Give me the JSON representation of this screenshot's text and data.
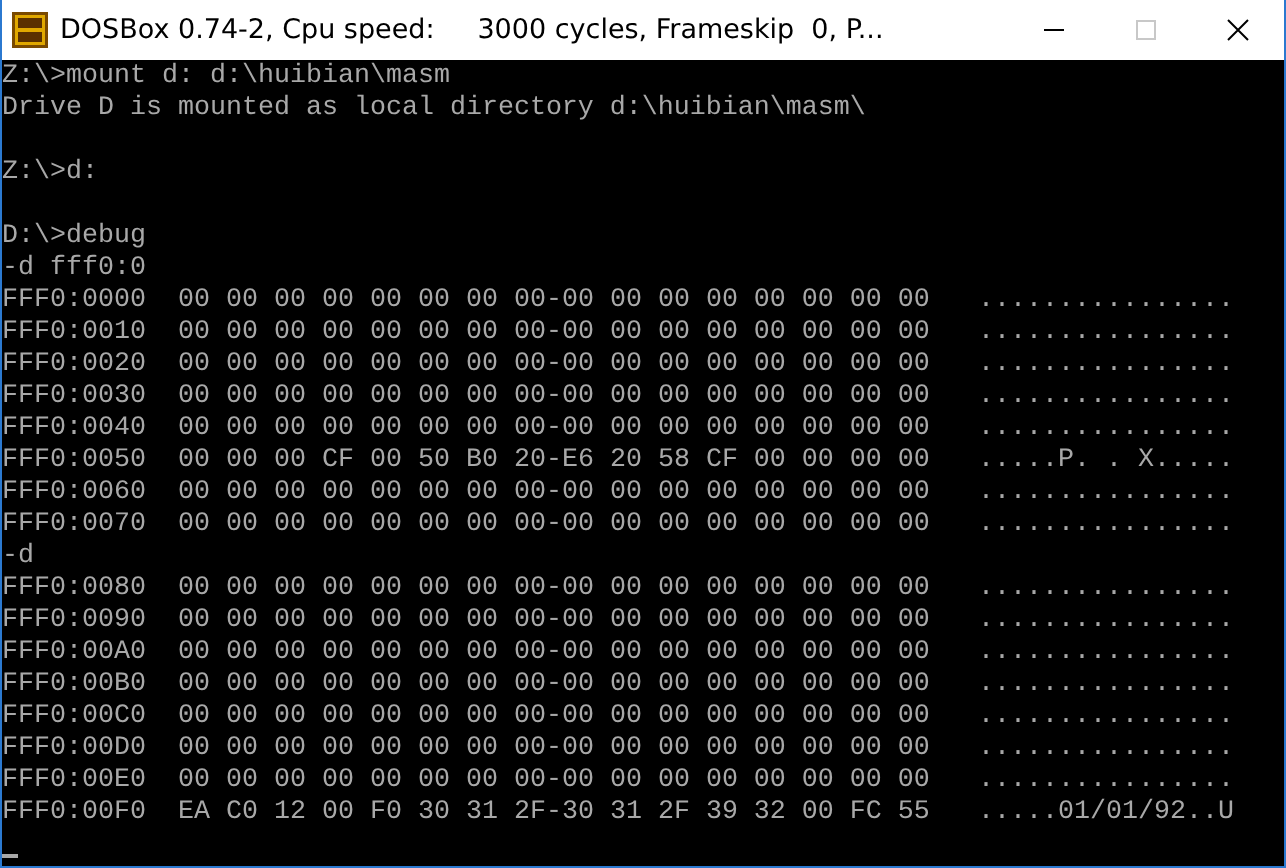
{
  "window": {
    "title": "DOSBox 0.74-2, Cpu speed:     3000 cycles, Frameskip  0, P...",
    "maximize_disabled": true
  },
  "console": [
    {
      "kind": "text",
      "text": "Z:\\>mount d: d:\\huibian\\masm"
    },
    {
      "kind": "text",
      "text": "Drive D is mounted as local directory d:\\huibian\\masm\\"
    },
    {
      "kind": "blank"
    },
    {
      "kind": "text",
      "text": "Z:\\>d:"
    },
    {
      "kind": "blank"
    },
    {
      "kind": "text",
      "text": "D:\\>debug"
    },
    {
      "kind": "text",
      "text": "-d fff0:0"
    },
    {
      "kind": "dump",
      "address": "FFF0:0000",
      "bytes": "00 00 00 00 00 00 00 00-00 00 00 00 00 00 00 00",
      "ascii": "................"
    },
    {
      "kind": "dump",
      "address": "FFF0:0010",
      "bytes": "00 00 00 00 00 00 00 00-00 00 00 00 00 00 00 00",
      "ascii": "................"
    },
    {
      "kind": "dump",
      "address": "FFF0:0020",
      "bytes": "00 00 00 00 00 00 00 00-00 00 00 00 00 00 00 00",
      "ascii": "................"
    },
    {
      "kind": "dump",
      "address": "FFF0:0030",
      "bytes": "00 00 00 00 00 00 00 00-00 00 00 00 00 00 00 00",
      "ascii": "................"
    },
    {
      "kind": "dump",
      "address": "FFF0:0040",
      "bytes": "00 00 00 00 00 00 00 00-00 00 00 00 00 00 00 00",
      "ascii": "................"
    },
    {
      "kind": "dump",
      "address": "FFF0:0050",
      "bytes": "00 00 00 CF 00 50 B0 20-E6 20 58 CF 00 00 00 00",
      "ascii": ".....P. . X....."
    },
    {
      "kind": "dump",
      "address": "FFF0:0060",
      "bytes": "00 00 00 00 00 00 00 00-00 00 00 00 00 00 00 00",
      "ascii": "................"
    },
    {
      "kind": "dump",
      "address": "FFF0:0070",
      "bytes": "00 00 00 00 00 00 00 00-00 00 00 00 00 00 00 00",
      "ascii": "................"
    },
    {
      "kind": "text",
      "text": "-d"
    },
    {
      "kind": "dump",
      "address": "FFF0:0080",
      "bytes": "00 00 00 00 00 00 00 00-00 00 00 00 00 00 00 00",
      "ascii": "................"
    },
    {
      "kind": "dump",
      "address": "FFF0:0090",
      "bytes": "00 00 00 00 00 00 00 00-00 00 00 00 00 00 00 00",
      "ascii": "................"
    },
    {
      "kind": "dump",
      "address": "FFF0:00A0",
      "bytes": "00 00 00 00 00 00 00 00-00 00 00 00 00 00 00 00",
      "ascii": "................"
    },
    {
      "kind": "dump",
      "address": "FFF0:00B0",
      "bytes": "00 00 00 00 00 00 00 00-00 00 00 00 00 00 00 00",
      "ascii": "................"
    },
    {
      "kind": "dump",
      "address": "FFF0:00C0",
      "bytes": "00 00 00 00 00 00 00 00-00 00 00 00 00 00 00 00",
      "ascii": "................"
    },
    {
      "kind": "dump",
      "address": "FFF0:00D0",
      "bytes": "00 00 00 00 00 00 00 00-00 00 00 00 00 00 00 00",
      "ascii": "................"
    },
    {
      "kind": "dump",
      "address": "FFF0:00E0",
      "bytes": "00 00 00 00 00 00 00 00-00 00 00 00 00 00 00 00",
      "ascii": "................"
    },
    {
      "kind": "dump",
      "address": "FFF0:00F0",
      "bytes": "EA C0 12 00 F0 30 31 2F-30 31 2F 39 32 00 FC 55",
      "ascii": ".....01/01/92..U"
    },
    {
      "kind": "cursor"
    }
  ]
}
